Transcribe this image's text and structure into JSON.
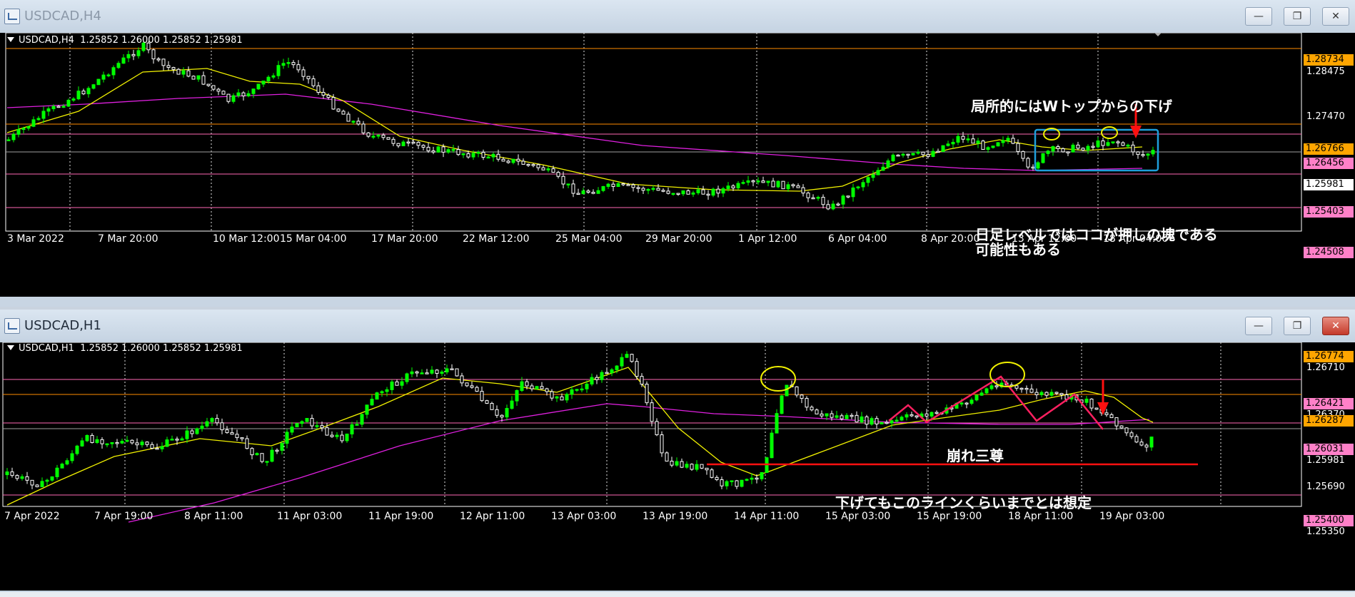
{
  "top_window": {
    "title": "USDCAD,H4",
    "header": "USDCAD,H4  1.25852 1.26000 1.25852 1.25981",
    "price_labels": [
      "1.28734",
      "1.26766",
      "1.26456",
      "1.25981",
      "1.25403",
      "1.24508"
    ],
    "ticks": [
      "1.28475",
      "1.27470"
    ],
    "x_labels": [
      "3 Mar 2022",
      "7 Mar 20:00",
      "10 Mar 12:00",
      "15 Mar 04:00",
      "17 Mar 20:00",
      "22 Mar 12:00",
      "25 Mar 04:00",
      "29 Mar 20:00",
      "1 Apr 12:00",
      "6 Apr 04:00",
      "8 Apr 20:00",
      "13 Apr 12:00",
      "18 Apr 04:00"
    ],
    "note_top": "局所的にはWトップからの下げ",
    "note_bottom_1": "日足レベルではココが押しの塊である",
    "note_bottom_2": "可能性もある"
  },
  "bottom_window": {
    "title": "USDCAD,H1",
    "header": "USDCAD,H1  1.25852 1.26000 1.25852 1.25981",
    "price_labels": [
      "1.26774",
      "1.26421",
      "1.26287",
      "1.26031",
      "1.25400"
    ],
    "ticks": [
      "1.26710",
      "1.26370",
      "1.25981",
      "1.25690",
      "1.25350"
    ],
    "x_labels": [
      "7 Apr 2022",
      "7 Apr 19:00",
      "8 Apr 11:00",
      "11 Apr 03:00",
      "11 Apr 19:00",
      "12 Apr 11:00",
      "13 Apr 03:00",
      "13 Apr 19:00",
      "14 Apr 11:00",
      "15 Apr 03:00",
      "15 Apr 19:00",
      "18 Apr 11:00",
      "19 Apr 03:00"
    ],
    "note_pattern": "崩れ三尊",
    "note_line": "下げてもこのラインくらいまでとは想定"
  },
  "window_buttons": {
    "minimize": "—",
    "maximize": "❐",
    "close": "✕"
  },
  "colors": {
    "bull": "#00ff00",
    "bear": "#ffffff",
    "ma_fast": "#f0f000",
    "ma_slow": "#e020e0",
    "orange_line": "#ff8c00",
    "pink_line": "#ff69b4",
    "orange_label": "#ffa500",
    "pink_label": "#ff80c8",
    "current_label": "#ffffff",
    "box": "#1e9fdc",
    "red": "#ff1010"
  }
}
